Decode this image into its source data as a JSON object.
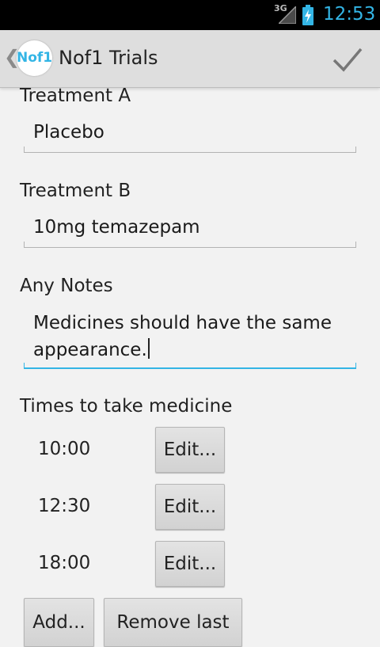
{
  "status_bar": {
    "network": "3G",
    "time": "12:53"
  },
  "action_bar": {
    "logo_text": "Nof1",
    "title": "Nof1 Trials"
  },
  "form": {
    "treatment_a": {
      "label": "Treatment A",
      "value": "Placebo"
    },
    "treatment_b": {
      "label": "Treatment B",
      "value": "10mg temazepam"
    },
    "notes": {
      "label": "Any Notes",
      "value_line1": "Medicines should have the same",
      "value_line2": "appearance."
    },
    "times": {
      "label": "Times to take medicine",
      "entries": [
        {
          "time": "10:00",
          "button": "Edit..."
        },
        {
          "time": "12:30",
          "button": "Edit..."
        },
        {
          "time": "18:00",
          "button": "Edit..."
        }
      ]
    },
    "add_button": "Add...",
    "remove_button": "Remove last"
  },
  "colors": {
    "accent": "#33b5e5",
    "action_bar": "#dedede",
    "background": "#f2f2f2"
  }
}
